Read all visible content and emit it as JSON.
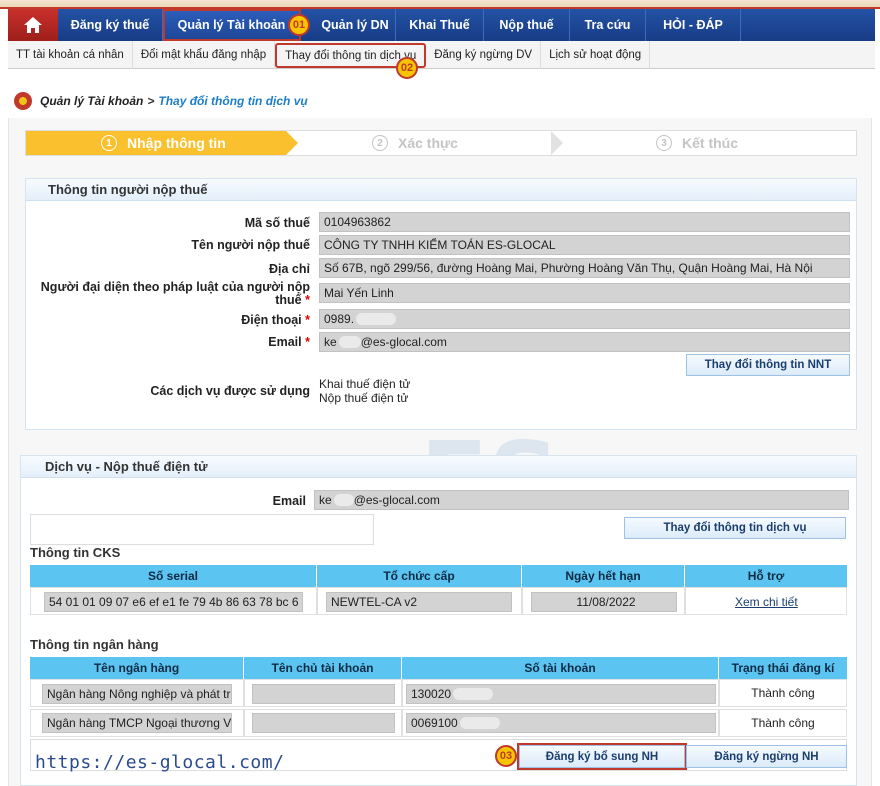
{
  "nav": {
    "items": [
      {
        "label": "Đăng ký thuế"
      },
      {
        "label": "Quản lý Tài khoản"
      },
      {
        "label": "Quản lý DN"
      },
      {
        "label": "Khai Thuế"
      },
      {
        "label": "Nộp thuế"
      },
      {
        "label": "Tra cứu"
      },
      {
        "label": "HỎI - ĐÁP"
      }
    ]
  },
  "subnav": {
    "items": [
      {
        "label": "TT tài khoản cá nhân"
      },
      {
        "label": "Đổi mật khẩu đăng nhập"
      },
      {
        "label": "Thay đổi thông tin dịch vụ"
      },
      {
        "label": "Đăng ký ngừng DV"
      },
      {
        "label": "Lịch sử hoạt động"
      }
    ]
  },
  "badges": [
    "01",
    "02",
    "03"
  ],
  "breadcrumb": {
    "parent": "Quản lý Tài khoản",
    "separator": ">",
    "current": "Thay đổi thông tin dịch vụ"
  },
  "steps": [
    {
      "num": "1",
      "label": "Nhập thông tin"
    },
    {
      "num": "2",
      "label": "Xác thực"
    },
    {
      "num": "3",
      "label": "Kết thúc"
    }
  ],
  "taxpayer": {
    "title": "Thông tin người nộp thuế",
    "tax_code_label": "Mã số thuế",
    "tax_code": "0104963862",
    "name_label": "Tên người nộp thuế",
    "name": "CÔNG TY TNHH KIỂM TOÁN ES-GLOCAL",
    "address_label": "Địa chỉ",
    "address": "Số 67B, ngõ 299/56, đường Hoàng Mai, Phường Hoàng Văn Thụ, Quận Hoàng Mai, Hà Nội",
    "rep_label_line1": "Người đại diện theo pháp luật của người nộp",
    "rep_label_line2": "thuế",
    "rep": "Mai Yến Linh",
    "phone_label": "Điện thoại",
    "phone": "0989.",
    "email_label": "Email",
    "email_prefix": "ke",
    "email_suffix": "@es-glocal.com",
    "required_mark": "*",
    "change_button": "Thay đổi thông tin NNT",
    "services_label": "Các dịch vụ được sử dụng",
    "services": [
      "Khai thuế điện tử",
      "Nộp thuế điện tử"
    ]
  },
  "service": {
    "title": "Dịch vụ - Nộp thuế điện tử",
    "email_label": "Email",
    "email_prefix": "ke",
    "email_suffix": "@es-glocal.com",
    "change_button": "Thay đổi thông tin dịch vụ"
  },
  "cks": {
    "title": "Thông tin CKS",
    "headers": [
      "Số serial",
      "Tổ chức cấp",
      "Ngày hết hạn",
      "Hỗ trợ"
    ],
    "serial": "54 01 01 09 07 e6 ef e1 fe 79 4b 86 63 78 bc 6",
    "issuer": "NEWTEL-CA v2",
    "expiry": "11/08/2022",
    "support_link": "Xem chi tiết"
  },
  "bank": {
    "title": "Thông tin ngân hàng",
    "headers": [
      "Tên ngân hàng",
      "Tên chủ tài khoản",
      "Số tài khoản",
      "Trạng thái đăng kí"
    ],
    "rows": [
      {
        "bank": "Ngân hàng Nông nghiệp và phát triển",
        "owner": "",
        "account": "130020",
        "status": "Thành công"
      },
      {
        "bank": "Ngân hàng TMCP Ngoại thương Việt Nam",
        "owner": "",
        "account": "0069100",
        "status": "Thành công"
      }
    ],
    "add_button": "Đăng ký bổ sung NH",
    "stop_button": "Đăng ký ngừng NH"
  },
  "watermark": "https://es-glocal.com/",
  "logo_text": "ES"
}
